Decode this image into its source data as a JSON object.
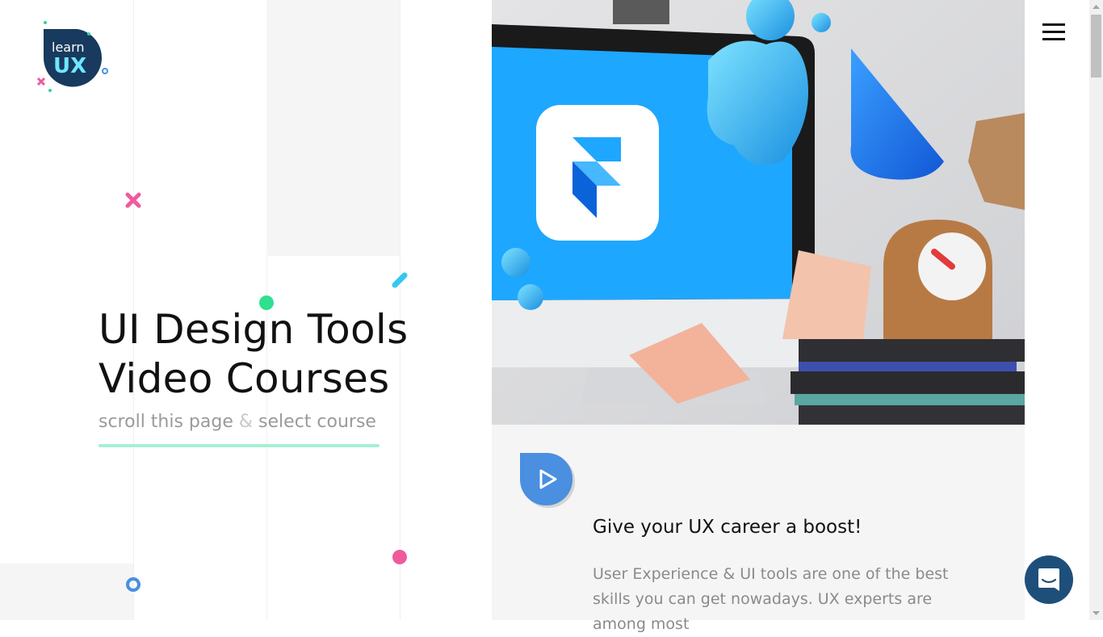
{
  "brand": {
    "logo_top": "learn",
    "logo_bottom": "UX"
  },
  "hero": {
    "title_line1": "UI Design Tools",
    "title_line2": "Video Courses",
    "subtitle_part1": "scroll this page",
    "subtitle_amp": "&",
    "subtitle_part2": "select course"
  },
  "card": {
    "title": "Give your UX career a boost!",
    "text": "User Experience & UI tools are one of the best skills you can get nowadays. UX experts are among most"
  },
  "icons": {
    "menu": "hamburger-menu-icon",
    "play": "play-icon",
    "chat": "chat-icon"
  },
  "colors": {
    "accent_blue": "#4a8fe0",
    "accent_green": "#a5f0d2",
    "accent_pink": "#f05a9d",
    "dark_navy": "#1e4f7a",
    "screen_blue": "#1ea7ff"
  }
}
